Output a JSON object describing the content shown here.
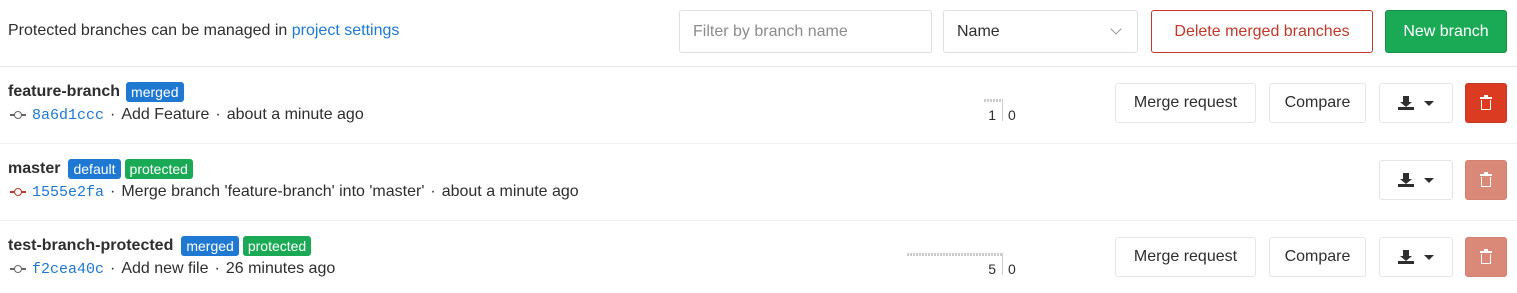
{
  "header": {
    "note_text": "Protected branches can be managed in ",
    "note_link": "project settings",
    "filter_placeholder": "Filter by branch name",
    "sort_selected": "Name",
    "delete_merged_label": "Delete merged branches",
    "new_branch_label": "New branch"
  },
  "branches": [
    {
      "name": "feature-branch",
      "badges": [
        "merged"
      ],
      "sha": "8a6d1ccc",
      "commit_message": "Add Feature",
      "time": "about a minute ago",
      "behind": "1",
      "ahead": "0",
      "merge_request_label": "Merge request",
      "compare_label": "Compare"
    },
    {
      "name": "master",
      "badges": [
        "default",
        "protected"
      ],
      "sha": "1555e2fa",
      "commit_message": "Merge branch 'feature-branch' into 'master'",
      "time": "about a minute ago"
    },
    {
      "name": "test-branch-protected",
      "badges": [
        "merged",
        "protected"
      ],
      "sha": "f2cea40c",
      "commit_message": "Add new file",
      "time": "26 minutes ago",
      "behind": "5",
      "ahead": "0",
      "merge_request_label": "Merge request",
      "compare_label": "Compare"
    }
  ],
  "separator": "·",
  "icons": {
    "commit": "commit-icon",
    "download": "download-icon",
    "dropdown": "caret-down-icon",
    "delete": "trash-icon",
    "sort": "chevron-down-icon"
  },
  "colors": {
    "link": "#1f78d1",
    "success": "#1aaa55",
    "danger": "#db3b21"
  }
}
